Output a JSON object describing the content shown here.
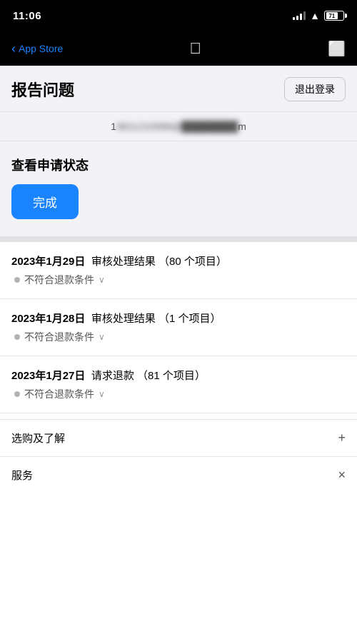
{
  "statusBar": {
    "time": "11:06",
    "battery": "71"
  },
  "navBar": {
    "backLabel": "App Store",
    "logoChar": "",
    "bagChar": "🛍"
  },
  "pageHeader": {
    "title": "报告问题",
    "logoutLabel": "退出登录"
  },
  "emailBanner": {
    "prefix": "1",
    "blurred": "9811210998@",
    "suffix": "m"
  },
  "viewStatus": {
    "title": "查看申请状态",
    "doneLabel": "完成"
  },
  "historyItems": [
    {
      "date": "2023年1月29日",
      "action": "审核处理结果",
      "detail": "（80 个项目）",
      "status": "不符合退款条件"
    },
    {
      "date": "2023年1月28日",
      "action": "审核处理结果",
      "detail": "（1 个项目）",
      "status": "不符合退款条件"
    },
    {
      "date": "2023年1月27日",
      "action": "请求退款",
      "detail": "（81 个项目）",
      "status": "不符合退款条件"
    }
  ],
  "footer": {
    "items": [
      {
        "label": "选购及了解",
        "icon": "+"
      },
      {
        "label": "服务",
        "icon": "×"
      }
    ]
  }
}
